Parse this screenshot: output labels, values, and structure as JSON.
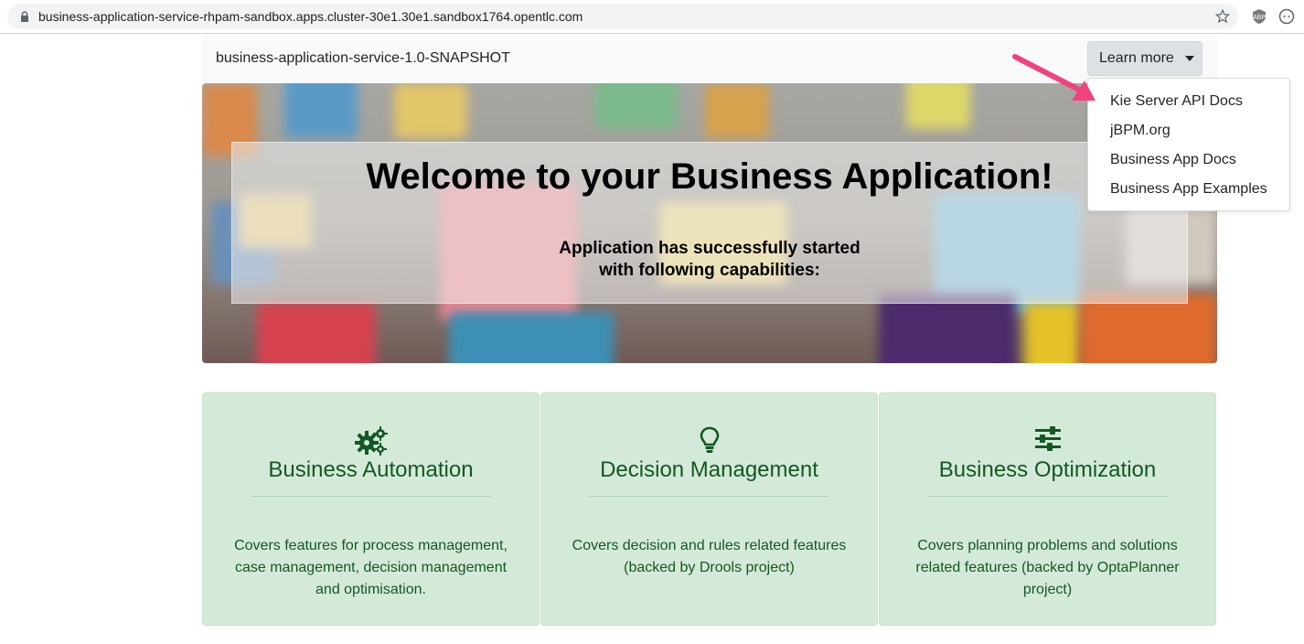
{
  "browser": {
    "url": "business-application-service-rhpam-sandbox.apps.cluster-30e1.30e1.sandbox1764.opentlc.com",
    "icons": [
      "lock-icon",
      "star-icon",
      "shield-extension-icon",
      "circle-extension-icon"
    ]
  },
  "navbar": {
    "brand": "business-application-service-1.0-SNAPSHOT",
    "learn_more_label": "Learn more",
    "dropdown_items": [
      "Kie Server API Docs",
      "jBPM.org",
      "Business App Docs",
      "Business App Examples"
    ]
  },
  "hero": {
    "title": "Welcome to your Business Application!",
    "subtitle_line1": "Application has successfully started",
    "subtitle_line2": "with following capabilities:"
  },
  "cards": [
    {
      "icon": "cogs-icon",
      "title": "Business Automation",
      "text": "Covers features for process management, case management, decision management and optimisation."
    },
    {
      "icon": "lightbulb-icon",
      "title": "Decision Management",
      "text": "Covers decision and rules related features (backed by Drools project)"
    },
    {
      "icon": "sliders-icon",
      "title": "Business Optimization",
      "text": "Covers planning problems and solutions related features (backed by OptaPlanner project)"
    }
  ],
  "colors": {
    "card_bg": "#d4ead8",
    "card_text": "#155724",
    "annotation_arrow": "#f0437e"
  }
}
